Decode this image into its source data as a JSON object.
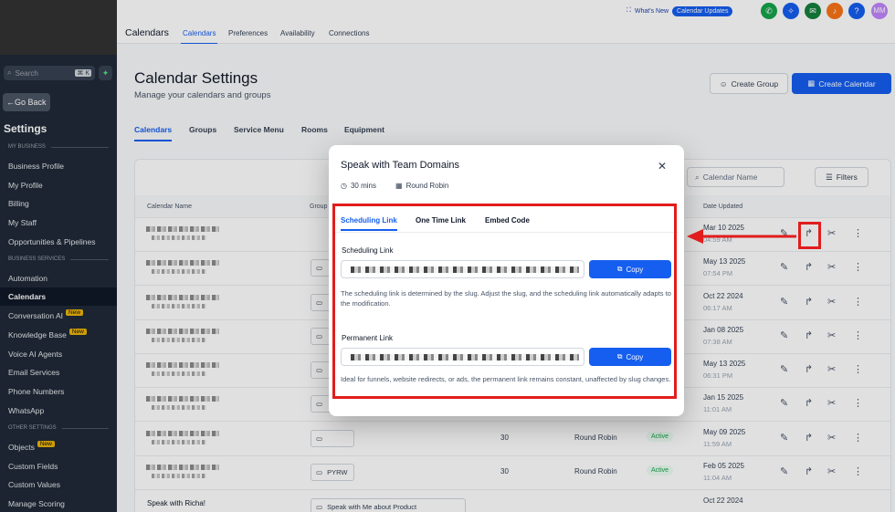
{
  "sidebar": {
    "search_placeholder": "Search",
    "search_shortcut": "⌘ K",
    "go_back": "Go Back",
    "title": "Settings",
    "sections": {
      "my_business": "MY BUSINESS",
      "business_services": "BUSINESS SERVICES",
      "other_settings": "OTHER SETTINGS"
    },
    "items": [
      {
        "label": "Business Profile",
        "new": ""
      },
      {
        "label": "My Profile",
        "new": ""
      },
      {
        "label": "Billing",
        "new": ""
      },
      {
        "label": "My Staff",
        "new": ""
      },
      {
        "label": "Opportunities & Pipelines",
        "new": ""
      },
      {
        "label": "Automation",
        "new": ""
      },
      {
        "label": "Calendars",
        "new": ""
      },
      {
        "label": "Conversation AI",
        "new": "New"
      },
      {
        "label": "Knowledge Base",
        "new": "New"
      },
      {
        "label": "Voice AI Agents",
        "new": ""
      },
      {
        "label": "Email Services",
        "new": ""
      },
      {
        "label": "Phone Numbers",
        "new": ""
      },
      {
        "label": "WhatsApp",
        "new": ""
      },
      {
        "label": "Objects",
        "new": "New"
      },
      {
        "label": "Custom Fields",
        "new": ""
      },
      {
        "label": "Custom Values",
        "new": ""
      },
      {
        "label": "Manage Scoring",
        "new": ""
      }
    ]
  },
  "topbar": {
    "title": "Calendars",
    "tabs": [
      "Calendars",
      "Preferences",
      "Availability",
      "Connections"
    ],
    "whats_new": "What's New",
    "updates": "Calendar Updates",
    "avatar": "MM",
    "help": "?"
  },
  "main": {
    "title": "Calendar Settings",
    "subtitle": "Manage your calendars and groups",
    "create_group": "Create Group",
    "create_calendar": "Create Calendar",
    "tabs": [
      "Calendars",
      "Groups",
      "Service Menu",
      "Rooms",
      "Equipment"
    ],
    "search_placeholder": "Calendar Name",
    "filters": "Filters",
    "columns": {
      "name": "Calendar Name",
      "group": "Group",
      "date": "Date Updated"
    },
    "rows": [
      {
        "name": "",
        "group": "",
        "duration": "",
        "type": "",
        "status": "",
        "date": "Mar 10 2025",
        "time": "04:59 AM"
      },
      {
        "name": "",
        "group": "",
        "duration": "",
        "type": "",
        "status": "",
        "date": "May 13 2025",
        "time": "07:54 PM"
      },
      {
        "name": "",
        "group": "",
        "duration": "",
        "type": "",
        "status": "",
        "date": "Oct 22 2024",
        "time": "06:17 AM"
      },
      {
        "name": "",
        "group": "",
        "duration": "",
        "type": "",
        "status": "",
        "date": "Jan 08 2025",
        "time": "07:38 AM"
      },
      {
        "name": "",
        "group": "",
        "duration": "",
        "type": "",
        "status": "",
        "date": "May 13 2025",
        "time": "06:31 PM"
      },
      {
        "name": "",
        "group": "",
        "duration": "",
        "type": "",
        "status": "",
        "date": "Jan 15 2025",
        "time": "11:01 AM"
      },
      {
        "name": "",
        "group": "",
        "duration": "30",
        "type": "Round Robin",
        "status": "Active",
        "date": "May 09 2025",
        "time": "11:59 AM"
      },
      {
        "name": "",
        "group": "PYRW",
        "duration": "30",
        "type": "Round Robin",
        "status": "Active",
        "date": "Feb 05 2025",
        "time": "11:04 AM"
      },
      {
        "name": "Speak with Richa!",
        "group": "Speak with Me about Product",
        "duration": "",
        "type": "",
        "status": "",
        "date": "Oct 22 2024",
        "time": ""
      }
    ]
  },
  "modal": {
    "title": "Speak with Team Domains",
    "duration": "30 mins",
    "type": "Round Robin",
    "tabs": [
      "Scheduling Link",
      "One Time Link",
      "Embed Code"
    ],
    "scheduling_label": "Scheduling Link",
    "copy": "Copy",
    "scheduling_help": "The scheduling link is determined by the slug. Adjust the slug, and the scheduling link automatically adapts to the modification.",
    "permanent_label": "Permanent Link",
    "permanent_help": "Ideal for funnels, website redirects, or ads, the permanent link remains constant, unaffected by slug changes."
  },
  "colors": {
    "primary": "#155eef",
    "highlight": "#e11d1d",
    "sidebar": "#1f2a37"
  }
}
